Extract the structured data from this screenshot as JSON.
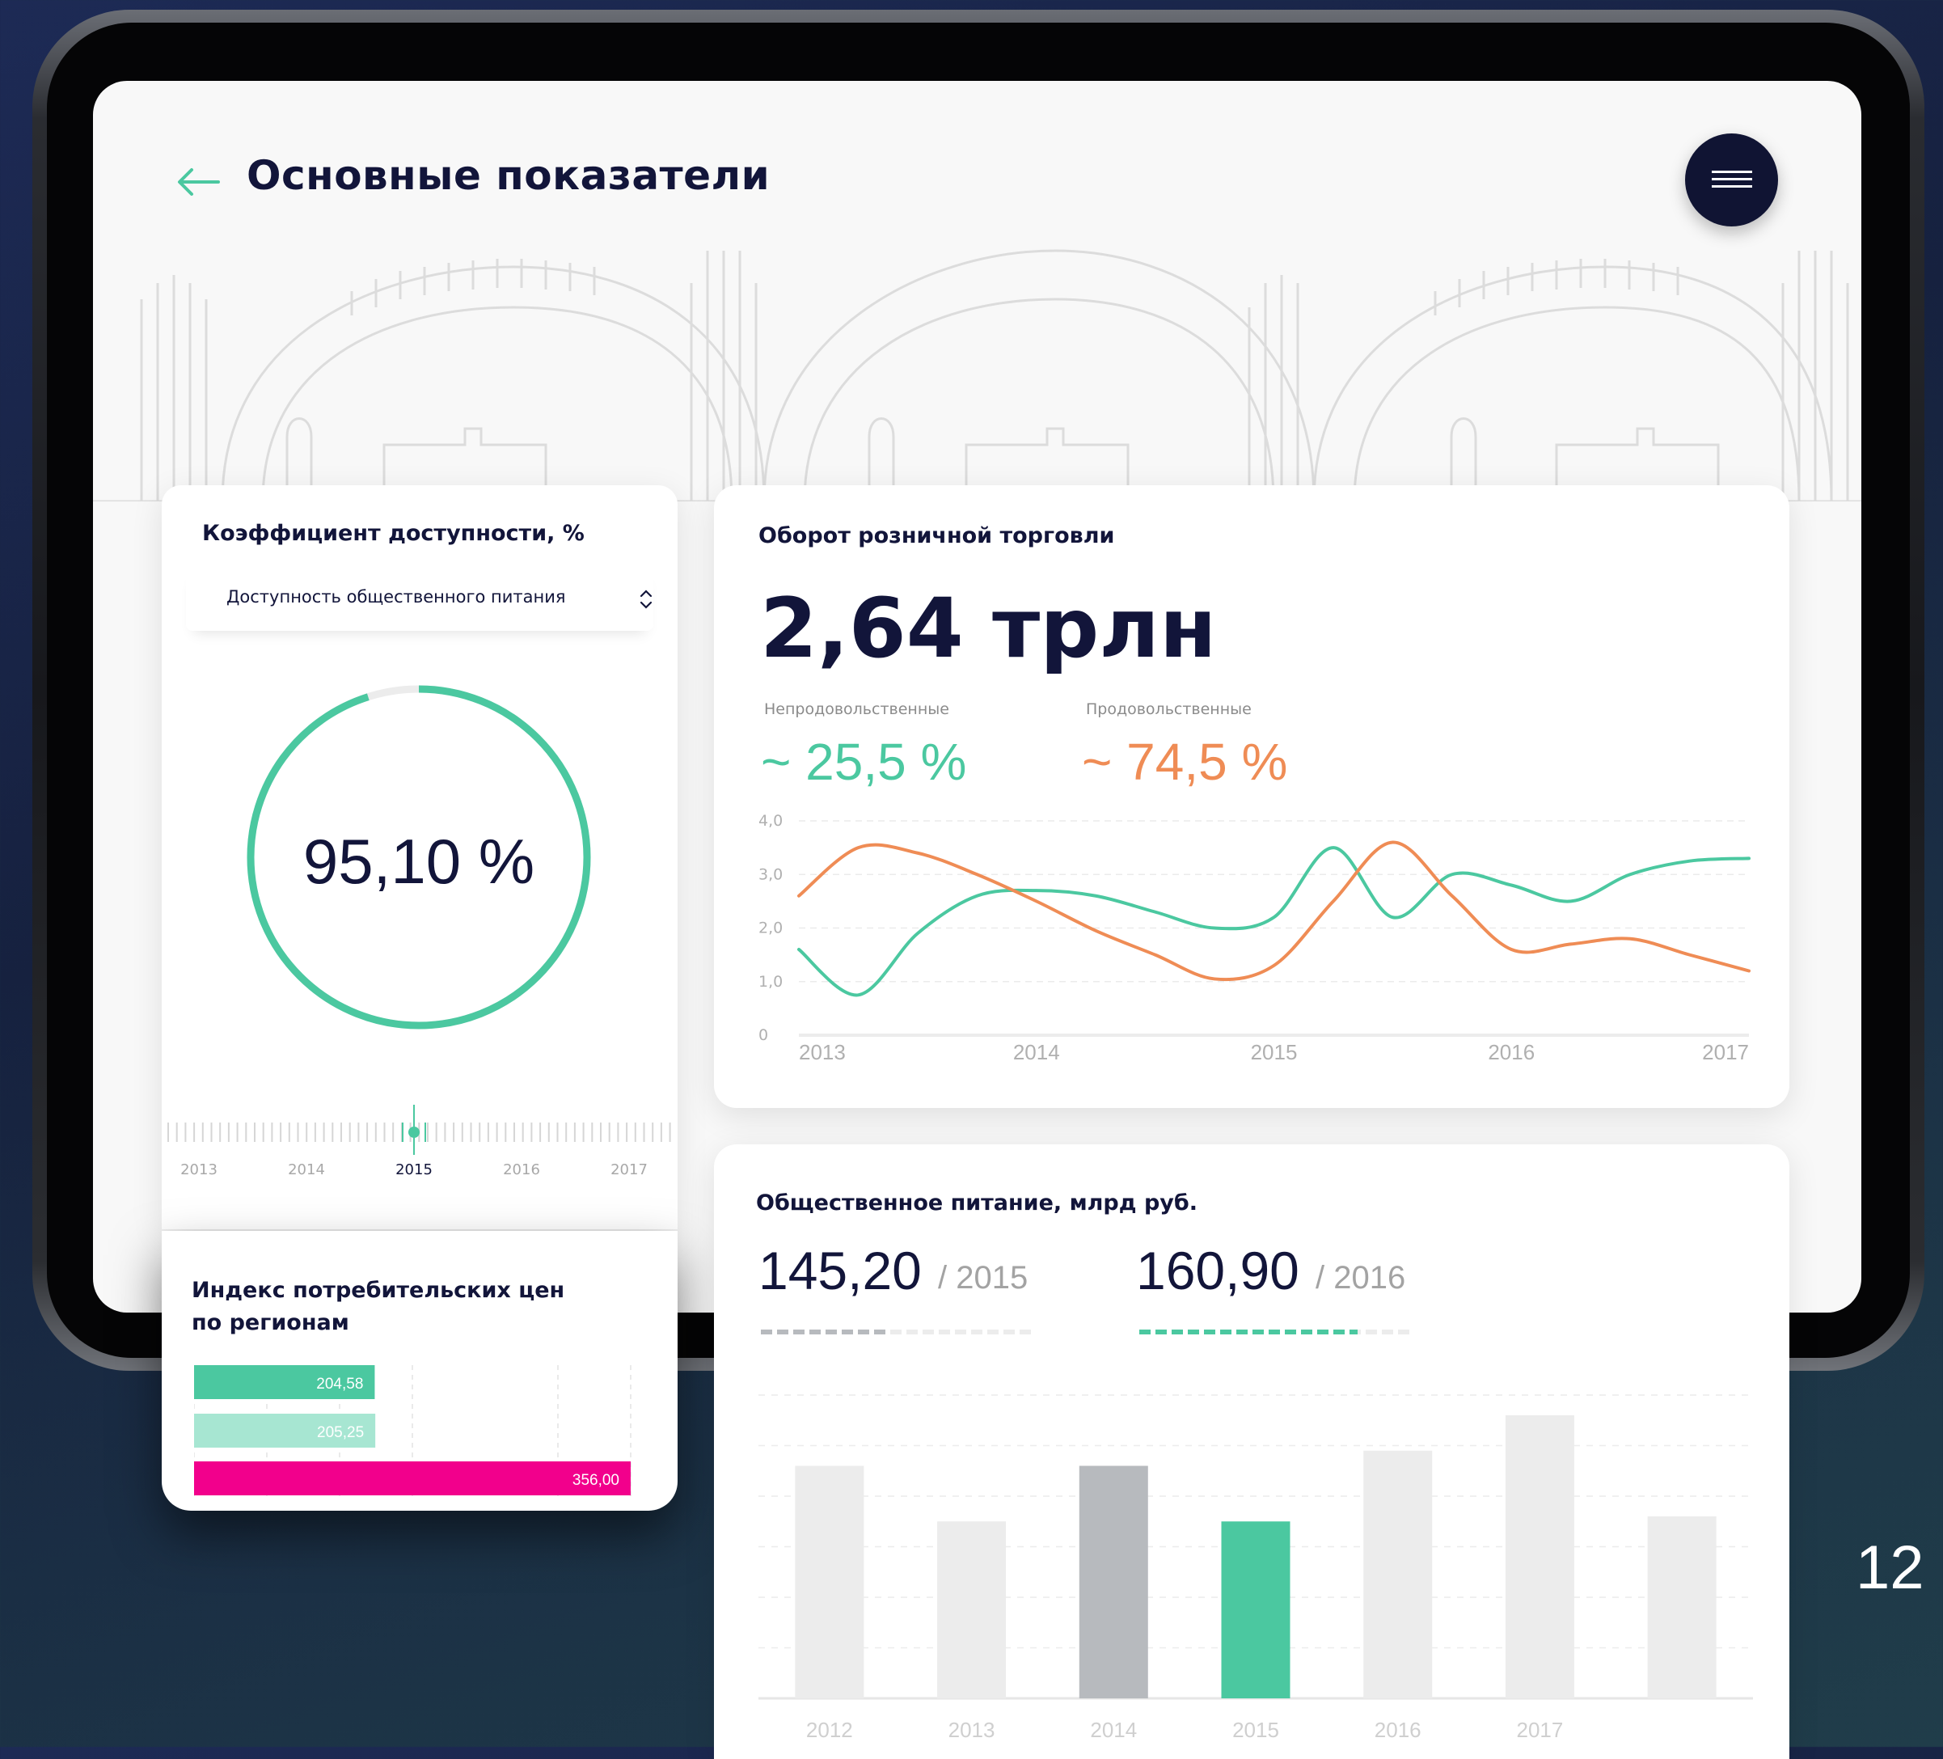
{
  "header": {
    "title": "Основные показатели"
  },
  "access_card": {
    "title": "Коэффициент доступности, %",
    "selector_value": "Доступность общественного питания",
    "gauge_value": "95,10 %",
    "gauge_fraction": 0.951,
    "timeline_years": [
      "2013",
      "2014",
      "2015",
      "2016",
      "2017"
    ],
    "timeline_selected": "2015"
  },
  "cpi_card": {
    "title_line1": "Индекс потребительских цен",
    "title_line2": "по регионам",
    "bars": [
      {
        "value": 204.58,
        "label": "204,58",
        "color": "#4bc8a0"
      },
      {
        "value": 205.25,
        "label": "205,25",
        "color": "#a7e6d2"
      },
      {
        "value": 356.0,
        "label": "356,00",
        "color": "#f2008c"
      }
    ]
  },
  "retail_card": {
    "title": "Оборот розничной торговли",
    "big_value": "2,64 трлн",
    "nonfood_label": "Непродовольственные",
    "nonfood_value": "~ 25,5 %",
    "food_label": "Продовольственные",
    "food_value": "~ 74,5 %",
    "colors": {
      "green": "#4bc8a0",
      "orange": "#ef8c55"
    }
  },
  "food_card": {
    "title": "Общественное питание, млрд руб.",
    "value_a": "145,20",
    "year_a": "/ 2015",
    "value_b": "160,90",
    "year_b": "/ 2016"
  },
  "page_number": "12",
  "chart_data": [
    {
      "type": "line",
      "title": "Оборот розничной торговли",
      "x": [
        2013,
        2013.25,
        2013.5,
        2013.75,
        2014,
        2014.25,
        2014.5,
        2014.75,
        2015,
        2015.25,
        2015.5,
        2015.75,
        2016,
        2016.25,
        2016.5,
        2016.75,
        2017
      ],
      "xticks": [
        "2013",
        "2014",
        "2015",
        "2016",
        "2017"
      ],
      "yticks": [
        "0",
        "1,0",
        "2,0",
        "3,0",
        "4,0"
      ],
      "ylim": [
        0,
        4
      ],
      "series": [
        {
          "name": "Непродовольственные",
          "color": "#4bc8a0",
          "values": [
            1.6,
            0.75,
            1.9,
            2.6,
            2.7,
            2.6,
            2.3,
            2.0,
            2.2,
            3.5,
            2.2,
            3.0,
            2.8,
            2.5,
            3.0,
            3.25,
            3.3
          ]
        },
        {
          "name": "Продовольственные",
          "color": "#ef8c55",
          "values": [
            2.6,
            3.5,
            3.4,
            3.0,
            2.5,
            1.95,
            1.5,
            1.05,
            1.3,
            2.5,
            3.6,
            2.6,
            1.6,
            1.7,
            1.8,
            1.5,
            1.2
          ]
        }
      ],
      "grid": true
    },
    {
      "type": "bar",
      "title": "Общественное питание, млрд руб.",
      "categories": [
        "2012",
        "2013",
        "2014",
        "2015",
        "2016",
        "2017",
        ""
      ],
      "values": [
        4.6,
        3.5,
        4.6,
        3.5,
        4.9,
        5.6,
        3.6
      ],
      "highlight": {
        "2014": "#b7babe",
        "2015": "#4bc8a0"
      },
      "bar_color": "#ececec",
      "grid": true
    }
  ]
}
